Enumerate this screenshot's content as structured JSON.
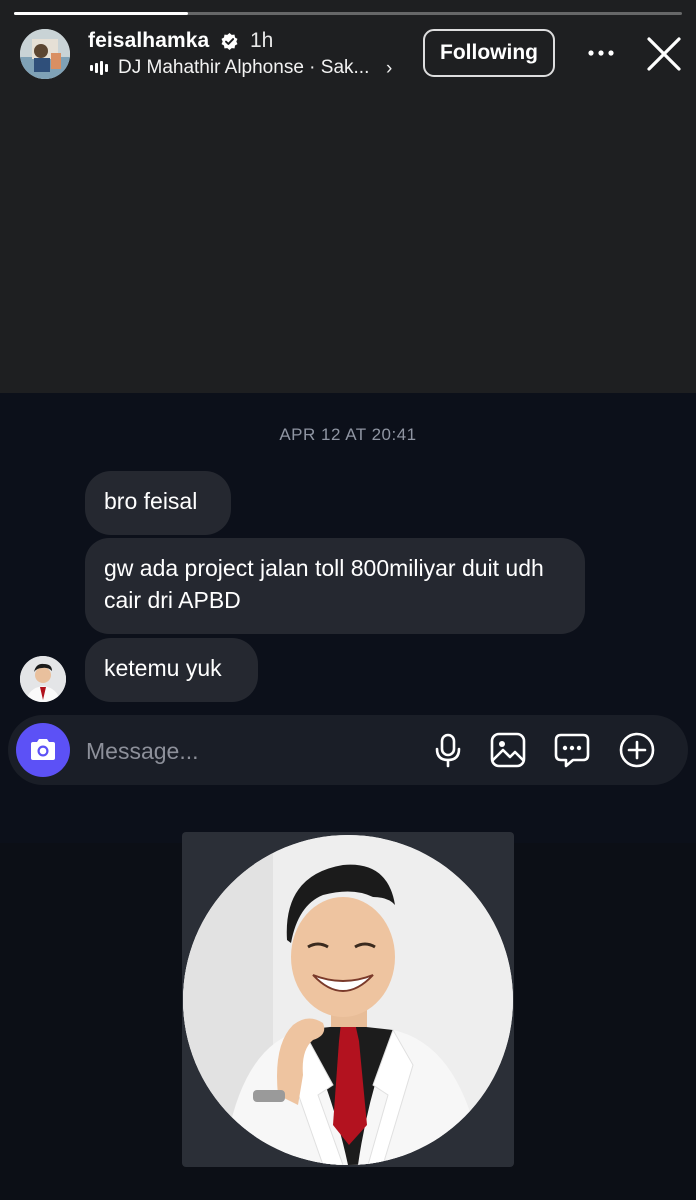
{
  "story": {
    "progress": 0.26,
    "username": "feisalhamka",
    "verified": true,
    "time_ago": "1h",
    "music": "DJ Mahathir Alphonse · Sak...",
    "follow_label": "Following"
  },
  "chat": {
    "timestamp": "APR 12 AT 20:41",
    "messages": [
      {
        "text": "bro feisal"
      },
      {
        "text": "gw ada project jalan toll 800miliyar duit udh cair dri APBD"
      },
      {
        "text": "ketemu yuk"
      }
    ]
  },
  "composer": {
    "placeholder": "Message..."
  },
  "icons": {
    "camera": "camera-icon",
    "mic": "microphone-icon",
    "gallery": "gallery-icon",
    "sticker": "sticker-icon",
    "plus": "plus-circle-icon",
    "more": "more-horizontal-icon",
    "close": "close-icon",
    "verified": "verified-badge-icon"
  },
  "colors": {
    "accent": "#5c51f6",
    "bubble": "#252830",
    "chat_bg": "#0c101a",
    "story_bg": "#1e1f21"
  }
}
